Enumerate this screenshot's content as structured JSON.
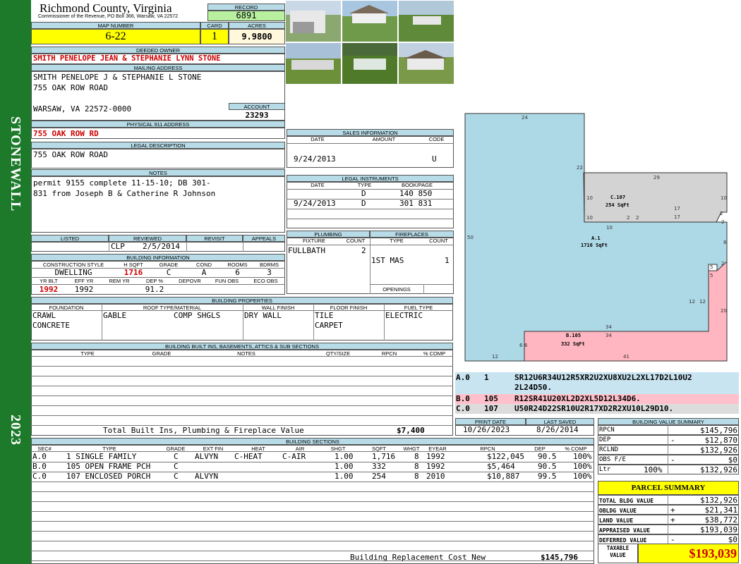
{
  "header": {
    "county": "Richmond County, Virginia",
    "office": "Commissioner of the Revenue, PO Box 366, Warsaw, VA 22572",
    "record_label": "RECORD",
    "record": "6891",
    "map_label": "MAP NUMBER",
    "map": "6-22",
    "card_label": "CARD",
    "card": "1",
    "acres_label": "ACRES",
    "acres": "9.9800"
  },
  "sidebar": {
    "district": "STONEWALL",
    "year": "2023"
  },
  "owner": {
    "deeded_label": "DEEDED OWNER",
    "deeded": "SMITH PENELOPE JEAN & STEPHANIE LYNN STONE",
    "mailing_label": "MAILING ADDRESS",
    "mail1": "SMITH PENELOPE J & STEPHANIE L STONE",
    "mail2": "755 OAK ROW ROAD",
    "mail3": "WARSAW, VA 22572-0000",
    "account_label": "ACCOUNT",
    "account": "23293",
    "phys_label": "PHYSICAL 911 ADDRESS",
    "phys": "755 OAK ROW RD",
    "legal_label": "LEGAL DESCRIPTION",
    "legal": "755 OAK ROW ROAD",
    "notes_label": "NOTES",
    "notes1": "permit 9155 complete 11-15-10; DB 301-",
    "notes2": "831 from Joseph B & Catherine R Johnson"
  },
  "review": {
    "listed_label": "LISTED",
    "reviewed_label": "REVIEWED",
    "revisit_label": "REVISIT",
    "appeals_label": "APPEALS",
    "reviewed_by": "CLP",
    "reviewed_date": "2/5/2014"
  },
  "building_info": {
    "label": "BUILDING INFORMATION",
    "cs_label": "CONSTRUCTION STYLE",
    "hsqft_label": "H SQFT",
    "grade_label": "GRADE",
    "cond_label": "COND",
    "rooms_label": "ROOMS",
    "bdrms_label": "BDRMS",
    "cs": "DWELLING",
    "hsqft": "1716",
    "grade": "C",
    "cond": "A",
    "rooms": "6",
    "bdrms": "3",
    "yrblt_label": "YR BLT",
    "effyr_label": "EFF YR",
    "remyr_label": "REM YR",
    "dep_label": "DEP %",
    "depovr_label": "DEPOVR",
    "funobs_label": "FUN OBS",
    "ecoobs_label": "ECO OBS",
    "yrblt": "1992",
    "effyr": "1992",
    "dep": "91.2"
  },
  "properties": {
    "label": "BUILDING PROPERTIES",
    "foundation_label": "FOUNDATION",
    "roof_label": "ROOF TYPE/MATERIAL",
    "wall_label": "WALL FINISH",
    "floor_label": "FLOOR FINISH",
    "fuel_label": "FUEL TYPE",
    "found1": "CRAWL",
    "found2": "CONCRETE",
    "roof1": "GABLE",
    "roof2": "COMP SHGLS",
    "wall": "DRY WALL",
    "floor1": "TILE",
    "floor2": "CARPET",
    "fuel": "ELECTRIC"
  },
  "builtins": {
    "label": "BUILDING BUILT INS, BASEMENTS, ATTICS & SUB SECTIONS",
    "cols": [
      "TYPE",
      "GRADE",
      "NOTES",
      "QTY/SIZE",
      "RPCN",
      "% COMP"
    ],
    "total_label": "Total Built Ins, Plumbing & Fireplace Value",
    "total": "$7,400"
  },
  "sales": {
    "label": "SALES INFORMATION",
    "cols": [
      "DATE",
      "AMOUNT",
      "CODE"
    ],
    "date": "9/24/2013",
    "code": "U"
  },
  "legal_instr": {
    "label": "LEGAL INSTRUMENTS",
    "cols": [
      "DATE",
      "TYPE",
      "BOOK/PAGE"
    ],
    "rows": [
      {
        "date": "",
        "type": "D",
        "book": "140 850"
      },
      {
        "date": "9/24/2013",
        "type": "D",
        "book": "301 831"
      }
    ]
  },
  "plumbing": {
    "label": "PLUMBING",
    "cols": [
      "FIXTURE",
      "COUNT"
    ],
    "fixture": "FULLBATH",
    "count": "2"
  },
  "fireplaces": {
    "label": "FIREPLACES",
    "cols": [
      "TYPE",
      "COUNT"
    ],
    "type": "1ST MAS",
    "count": "1",
    "openings_label": "OPENINGS"
  },
  "sketch": {
    "labels": {
      "a": "A.1",
      "a_area": "1716 SqFt",
      "b": "B.105",
      "b_area": "332 SqFt",
      "c": "C.107",
      "c_area": "254 SqFt"
    },
    "dims": [
      "24",
      "22",
      "29",
      "10",
      "10",
      "50",
      "10",
      "10",
      "2",
      "2",
      "17",
      "17",
      "2",
      "2",
      "8",
      "5",
      "5",
      "2",
      "12",
      "12",
      "20",
      "34",
      "34",
      "6",
      "6",
      "12",
      "41"
    ],
    "colors": {
      "a": "#add8e6",
      "b": "#ffb6c1",
      "c": "#d3d3d3"
    }
  },
  "trace": [
    {
      "sec": "A.0",
      "code": "1",
      "text1": "SR12U6R34U12R5XR2U2XU8XU2L2XL17D2L10U2",
      "text2": "2L24D50."
    },
    {
      "sec": "B.0",
      "code": "105",
      "text1": "R12SR41U20XL2D2XL5D12L34D6."
    },
    {
      "sec": "C.0",
      "code": "107",
      "text1": "U50R24D22SR10U2R17XD2R2XU10L29D10."
    }
  ],
  "dates": {
    "print_label": "PRINT DATE",
    "print": "10/26/2023",
    "saved_label": "LAST SAVED",
    "saved": "8/26/2014"
  },
  "value_summary": {
    "label": "BUILDING VALUE SUMMARY",
    "rows": [
      {
        "k": "RPCN",
        "sign": "",
        "v": "$145,796"
      },
      {
        "k": "DEP",
        "sign": "-",
        "v": "$12,870"
      },
      {
        "k": "RCLND",
        "sign": "",
        "v": "$132,926"
      },
      {
        "k": "OBS F/E",
        "sign": "-",
        "v": "$0"
      },
      {
        "k": "Ltr",
        "pct": "100%",
        "sign": "",
        "v": "$132,926"
      }
    ]
  },
  "sections": {
    "label": "BUILDING SECTIONS",
    "cols": [
      "SEC#",
      "TYPE",
      "GRADE",
      "EXT FIN",
      "HEAT",
      "AIR",
      "SHGT",
      "SQFT",
      "WHGT",
      "EYEAR",
      "RPCN",
      "DEP",
      "% COMP"
    ],
    "rows": [
      {
        "sec": "A.0",
        "type": "1 SINGLE FAMILY",
        "grade": "C",
        "ext": "ALVYN",
        "heat": "C-HEAT",
        "air": "C-AIR",
        "shgt": "1.00",
        "sqft": "1,716",
        "whgt": "8",
        "eyear": "1992",
        "rpcn": "$122,045",
        "dep": "90.5",
        "comp": "100%"
      },
      {
        "sec": "B.0",
        "type": "105 OPEN FRAME PCH",
        "grade": "C",
        "ext": "",
        "heat": "",
        "air": "",
        "shgt": "1.00",
        "sqft": "332",
        "whgt": "8",
        "eyear": "1992",
        "rpcn": "$5,464",
        "dep": "90.5",
        "comp": "100%"
      },
      {
        "sec": "C.0",
        "type": "107 ENCLOSED PORCH",
        "grade": "C",
        "ext": "ALVYN",
        "heat": "",
        "air": "",
        "shgt": "1.00",
        "sqft": "254",
        "whgt": "8",
        "eyear": "2010",
        "rpcn": "$10,887",
        "dep": "99.5",
        "comp": "100%"
      }
    ],
    "replacement_label": "Building Replacement Cost New",
    "replacement": "$145,796"
  },
  "parcel": {
    "label": "PARCEL SUMMARY",
    "rows": [
      {
        "k": "TOTAL BLDG VALUE",
        "sign": "",
        "v": "$132,926"
      },
      {
        "k": "OBLDG VALUE",
        "sign": "+",
        "v": "$21,341"
      },
      {
        "k": "LAND VALUE",
        "sign": "+",
        "v": "$38,772"
      },
      {
        "k": "APPRAISED VALUE",
        "sign": "",
        "v": "$193,039"
      },
      {
        "k": "DEFERRED VALUE",
        "sign": "-",
        "v": "$0"
      }
    ],
    "taxable_label1": "TAXABLE",
    "taxable_label2": "VALUE",
    "taxable": "$193,039"
  }
}
